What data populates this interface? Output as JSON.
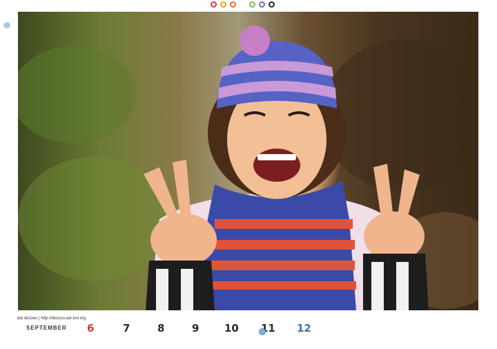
{
  "header": {
    "dots": [
      {
        "icon": "color-dot-icon",
        "color": "#e0306a"
      },
      {
        "icon": "color-dot-icon",
        "color": "#f2a21c"
      },
      {
        "icon": "color-dot-icon",
        "color": "#f06b1d"
      },
      {
        "icon": "color-dot-icon",
        "color": "#7cc242"
      },
      {
        "icon": "color-dot-icon",
        "color": "#8f63b8"
      },
      {
        "icon": "color-dot-icon",
        "color": "#222222"
      }
    ]
  },
  "photo": {
    "icon": "portrait-photo-icon"
  },
  "footer": {
    "site_text": "dai dezoou | http://dezoou.aoi-tori.org",
    "month": "SEPTEMBER",
    "days": [
      {
        "label": "6",
        "color": "#d9382f"
      },
      {
        "label": "7",
        "color": "#2a2a2a"
      },
      {
        "label": "8",
        "color": "#2a2a2a"
      },
      {
        "label": "9",
        "color": "#2a2a2a"
      },
      {
        "label": "10",
        "color": "#2a2a2a"
      },
      {
        "label": "11",
        "color": "#2a2a2a"
      },
      {
        "label": "12",
        "color": "#3a6fbf"
      }
    ]
  }
}
